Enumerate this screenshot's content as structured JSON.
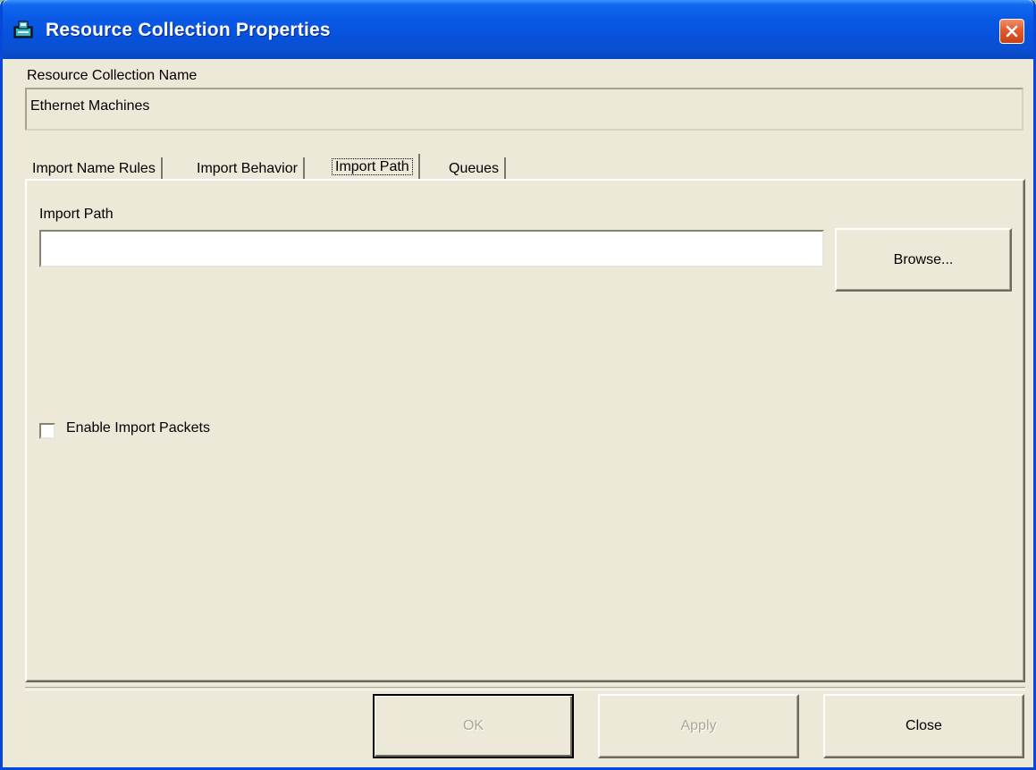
{
  "window": {
    "title": "Resource Collection Properties",
    "app_icon": "resource-collection-icon",
    "close_icon": "close-icon"
  },
  "collection_name": {
    "label": "Resource Collection Name",
    "value": "Ethernet Machines"
  },
  "tabs": [
    {
      "label": "Import Name Rules",
      "active": false
    },
    {
      "label": "Import Behavior",
      "active": false
    },
    {
      "label": "Import Path",
      "active": true
    },
    {
      "label": "Queues",
      "active": false
    }
  ],
  "import_path": {
    "label": "Import Path",
    "value": "",
    "browse_label": "Browse..."
  },
  "enable_import_packets": {
    "label": "Enable Import Packets",
    "checked": false
  },
  "footer": {
    "ok_label": "OK",
    "apply_label": "Apply",
    "close_label": "Close"
  },
  "colors": {
    "titlebar": "#0a5ae6",
    "dialog_bg": "#ece9d8",
    "close_button": "#e2592c",
    "disabled_text": "#a9a796"
  }
}
